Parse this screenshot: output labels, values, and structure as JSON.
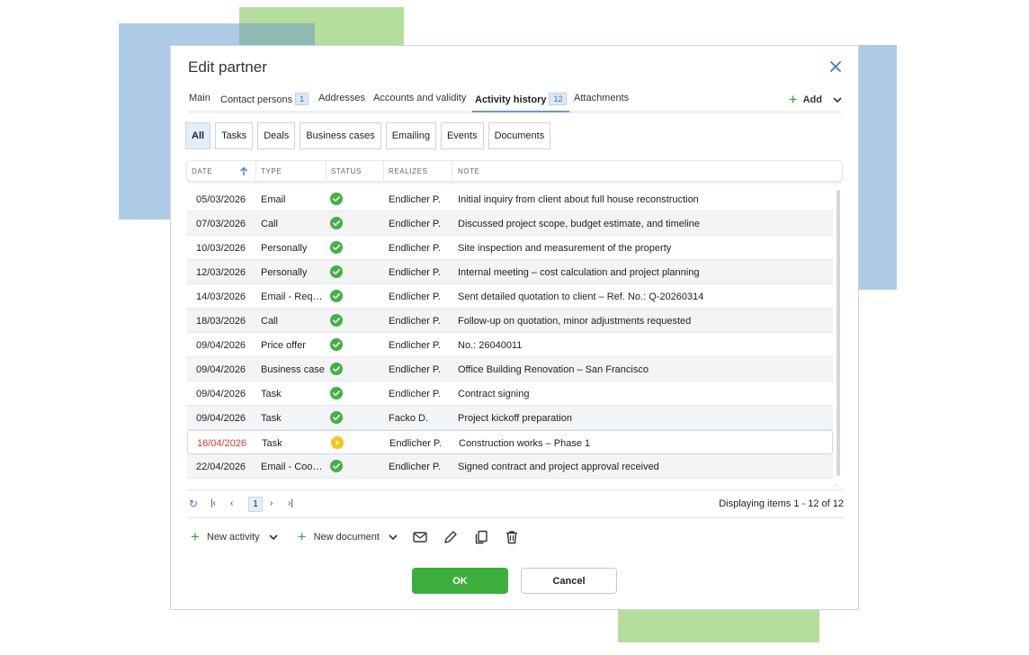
{
  "dialog": {
    "title": "Edit partner"
  },
  "tabs": [
    {
      "label": "Main",
      "badge": null
    },
    {
      "label": "Contact persons",
      "badge": "1"
    },
    {
      "label": "Addresses",
      "badge": null
    },
    {
      "label": "Accounts and validity",
      "badge": null
    },
    {
      "label": "Activity history",
      "badge": "12"
    },
    {
      "label": "Attachments",
      "badge": null
    }
  ],
  "tab_active": "Activity history",
  "add_button": {
    "label": "Add"
  },
  "filters": [
    "All",
    "Tasks",
    "Deals",
    "Business cases",
    "Emailing",
    "Events",
    "Documents"
  ],
  "filter_active": "All",
  "columns": [
    "DATE",
    "TYPE",
    "STATUS",
    "REALIZES",
    "NOTE"
  ],
  "rows": [
    {
      "date": "05/03/2026",
      "type": "Email",
      "status": "done",
      "realizes": "Endlicher P.",
      "note": "Initial inquiry from client about full house reconstruction"
    },
    {
      "date": "07/03/2026",
      "type": "Call",
      "status": "done",
      "realizes": "Endlicher P.",
      "note": "Discussed project scope, budget estimate, and timeline"
    },
    {
      "date": "10/03/2026",
      "type": "Personally",
      "status": "done",
      "realizes": "Endlicher P.",
      "note": "Site inspection and measurement of the property"
    },
    {
      "date": "12/03/2026",
      "type": "Personally",
      "status": "done",
      "realizes": "Endlicher P.",
      "note": "Internal meeting – cost calculation and project planning"
    },
    {
      "date": "14/03/2026",
      "type": "Email - Requ...",
      "status": "done",
      "realizes": "Endlicher P.",
      "note": "Sent detailed quotation to client – Ref. No.: Q-20260314"
    },
    {
      "date": "18/03/2026",
      "type": "Call",
      "status": "done",
      "realizes": "Endlicher P.",
      "note": "Follow-up on quotation, minor adjustments requested"
    },
    {
      "date": "09/04/2026",
      "type": "Price offer",
      "status": "done",
      "realizes": "Endlicher P.",
      "note": "No.: 26040011"
    },
    {
      "date": "09/04/2026",
      "type": "Business case",
      "status": "done",
      "realizes": "Endlicher P.",
      "note": "Office Building Renovation – San Francisco"
    },
    {
      "date": "09/04/2026",
      "type": "Task",
      "status": "done",
      "realizes": "Endlicher P.",
      "note": "Contract signing"
    },
    {
      "date": "09/04/2026",
      "type": "Task",
      "status": "done",
      "realizes": "Facko D.",
      "note": "Project kickoff preparation"
    },
    {
      "date": "16/04/2026",
      "type": "Task",
      "status": "in-progress",
      "realizes": "Endlicher P.",
      "note": "Construction works – Phase 1",
      "overdue": true
    },
    {
      "date": "22/04/2026",
      "type": "Email - Coop...",
      "status": "done",
      "realizes": "Endlicher P.",
      "note": "Signed contract and project approval received"
    }
  ],
  "pager": {
    "page": "1",
    "info": "Displaying items 1 - 12 of 12"
  },
  "actions": {
    "new_activity": "New activity",
    "new_document": "New document"
  },
  "buttons": {
    "ok": "OK",
    "cancel": "Cancel"
  },
  "colors": {
    "accent_green": "#3cae3c",
    "status_done": "#43b043",
    "status_progress": "#f5c518",
    "overdue_red": "#d23a2e",
    "tab_underline": "#6a96c5"
  },
  "icons": [
    "close-icon",
    "plus-icon",
    "chevron-down-icon",
    "sort-asc-icon",
    "check-circle-icon",
    "play-circle-icon",
    "refresh-icon",
    "first-page-icon",
    "prev-page-icon",
    "next-page-icon",
    "last-page-icon",
    "mail-icon",
    "pencil-icon",
    "copy-icon",
    "trash-icon"
  ]
}
